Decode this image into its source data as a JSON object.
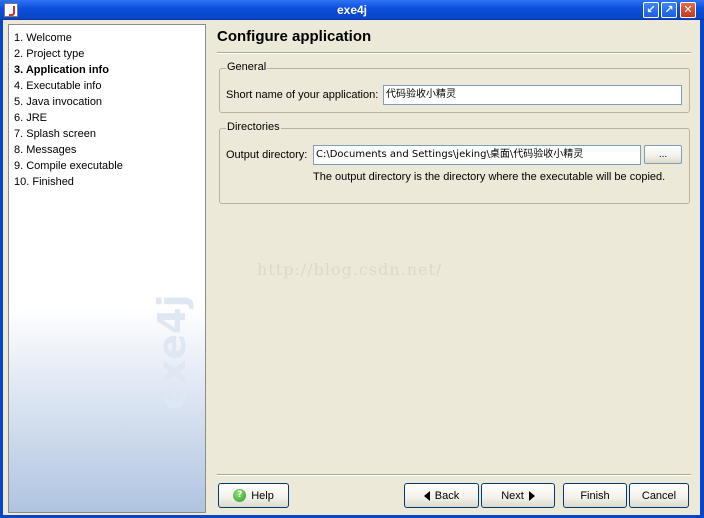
{
  "window": {
    "title": "exe4j",
    "controls": [
      "minimize-icon",
      "restore-icon",
      "close-icon"
    ]
  },
  "steps": {
    "items": [
      {
        "label": "1. Welcome",
        "active": false
      },
      {
        "label": "2. Project type",
        "active": false
      },
      {
        "label": "3. Application info",
        "active": true
      },
      {
        "label": "4. Executable info",
        "active": false
      },
      {
        "label": "5. Java invocation",
        "active": false
      },
      {
        "label": "6. JRE",
        "active": false
      },
      {
        "label": "7. Splash screen",
        "active": false
      },
      {
        "label": "8. Messages",
        "active": false
      },
      {
        "label": "9. Compile executable",
        "active": false
      },
      {
        "label": "10. Finished",
        "active": false
      }
    ],
    "brand": "exe4j"
  },
  "main": {
    "title": "Configure application",
    "general": {
      "legend": "General",
      "short_name_label": "Short name of your application:",
      "short_name_value": "代码验收小精灵"
    },
    "directories": {
      "legend": "Directories",
      "output_label": "Output directory:",
      "output_value": "C:\\Documents and Settings\\jeking\\桌面\\代码验收小精灵",
      "browse_label": "...",
      "hint": "The output directory is the directory where the executable will be copied."
    },
    "watermark": "http://blog.csdn.net/"
  },
  "buttons": {
    "help": "Help",
    "back": "Back",
    "next": "Next",
    "finish": "Finish",
    "cancel": "Cancel"
  },
  "colors": {
    "titlebar": "#0a4fd9",
    "background": "#ece9d8",
    "steps_gradient_end": "#b0c4e0"
  }
}
